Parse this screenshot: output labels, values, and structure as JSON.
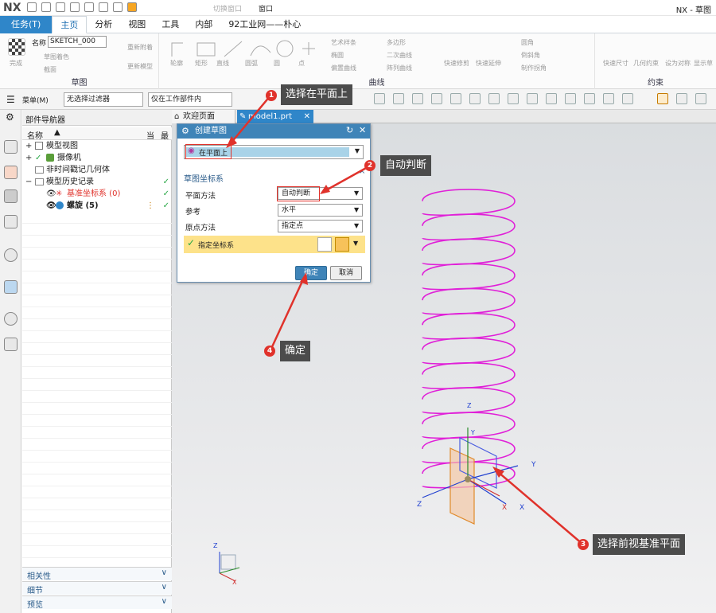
{
  "titlebar": {
    "logo": "NX",
    "switch_window": "切换窗口",
    "window_menu": "窗口",
    "app_title": "NX - 草图"
  },
  "ribbon_tabs": {
    "task": "任务(T)",
    "items": [
      "主页",
      "分析",
      "视图",
      "工具",
      "内部",
      "92工业网——朴心"
    ]
  },
  "ribbon": {
    "sketch_group": {
      "label": "草图",
      "finish": "完成",
      "name_label": "名称",
      "name_value": "SKETCH_000",
      "items": [
        "草图着色",
        "截面"
      ],
      "recompute": [
        "重新附着",
        "更新模型"
      ]
    },
    "curve_group": {
      "label": "曲线",
      "items": [
        "轮廓",
        "矩形",
        "直线",
        "圆弧",
        "圆",
        "点",
        "艺术样条",
        "椭圆",
        "偏置曲线",
        "多边形",
        "二次曲线",
        "阵列曲线",
        "快速修剪",
        "快速延伸",
        "圆角",
        "倒斜角",
        "制作拐角"
      ]
    },
    "constraint_group": {
      "label": "约束",
      "items": [
        "快速尺寸",
        "几何约束",
        "设为对称",
        "显示草"
      ]
    }
  },
  "toolbar": {
    "menu": "菜单(M)",
    "filter": "无选择过滤器",
    "scope": "仅在工作部件内"
  },
  "nav": {
    "title": "部件导航器",
    "header": {
      "name": "名称",
      "col1": "当",
      "col2": "最"
    },
    "rows": [
      {
        "label": "模型视图",
        "check": ""
      },
      {
        "label": "摄像机",
        "check": ""
      },
      {
        "label": "非时间戳记几何体",
        "check": ""
      },
      {
        "label": "模型历史记录",
        "check": "✓"
      },
      {
        "label": "基准坐标系 (0)",
        "check": "✓"
      },
      {
        "label": "螺旋 (5)",
        "check": "✓"
      }
    ],
    "accordions": [
      "相关性",
      "细节",
      "预览"
    ]
  },
  "doc_tabs": {
    "welcome": "欢迎页面",
    "model": "model1.prt"
  },
  "dialog": {
    "title": "创建草图",
    "type_value": "在平面上",
    "section": "草图坐标系",
    "plane_label": "平面方法",
    "plane_value": "自动判断",
    "ref_label": "参考",
    "ref_value": "水平",
    "origin_label": "原点方法",
    "origin_value": "指定点",
    "csys_label": "指定坐标系",
    "ok": "确定",
    "cancel": "取消"
  },
  "callouts": [
    {
      "num": "1",
      "text": "选择在平面上"
    },
    {
      "num": "2",
      "text": "自动判断"
    },
    {
      "num": "3",
      "text": "选择前视基准平面"
    },
    {
      "num": "4",
      "text": "确定"
    }
  ],
  "axes": {
    "x": "X",
    "y": "Y",
    "z": "Z"
  },
  "colors": {
    "accent": "#2f86c9",
    "helix": "#e020d8",
    "callout_bg": "#4c4c4c",
    "badge": "#e0322b"
  }
}
